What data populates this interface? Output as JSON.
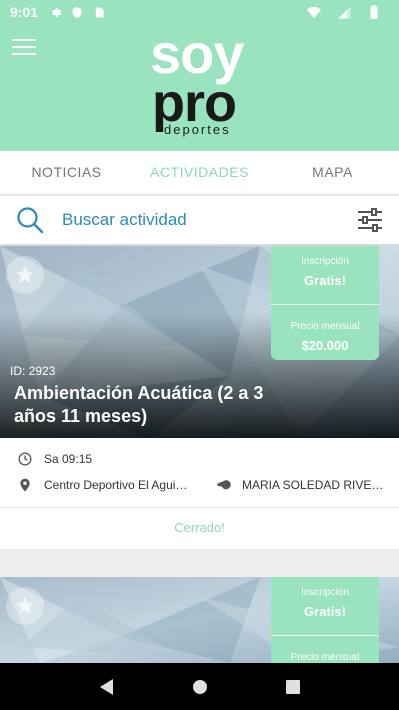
{
  "statusbar": {
    "time": "9:01"
  },
  "header": {
    "logo_line1": "soy",
    "logo_line2": "pro",
    "logo_line3": "deportes"
  },
  "tabs": [
    {
      "label": "NOTICIAS",
      "active": false
    },
    {
      "label": "ACTIVIDADES",
      "active": true
    },
    {
      "label": "MAPA",
      "active": false
    }
  ],
  "search": {
    "placeholder": "Buscar actividad"
  },
  "cards": [
    {
      "inscription_label": "Inscripción",
      "inscription_value": "Gratis!",
      "monthly_label": "Precio mensual",
      "monthly_value": "$20.000",
      "id_text": "ID: 2923",
      "title": "Ambientación Acuática (2 a 3  años 11 meses)",
      "schedule": "Sa 09:15",
      "location": "Centro Deportivo El Aguilucho",
      "instructor": "MARIA SOLEDAD RIVERA MARTINEZ",
      "status": "Cerrado!"
    },
    {
      "inscription_label": "Inscripción",
      "inscription_value": "Gratis!",
      "monthly_label": "Precio mensual"
    }
  ],
  "colors": {
    "accent": "#99e3bf",
    "accent_text": "#8dd7b5",
    "search_text": "#2b8ab8"
  }
}
